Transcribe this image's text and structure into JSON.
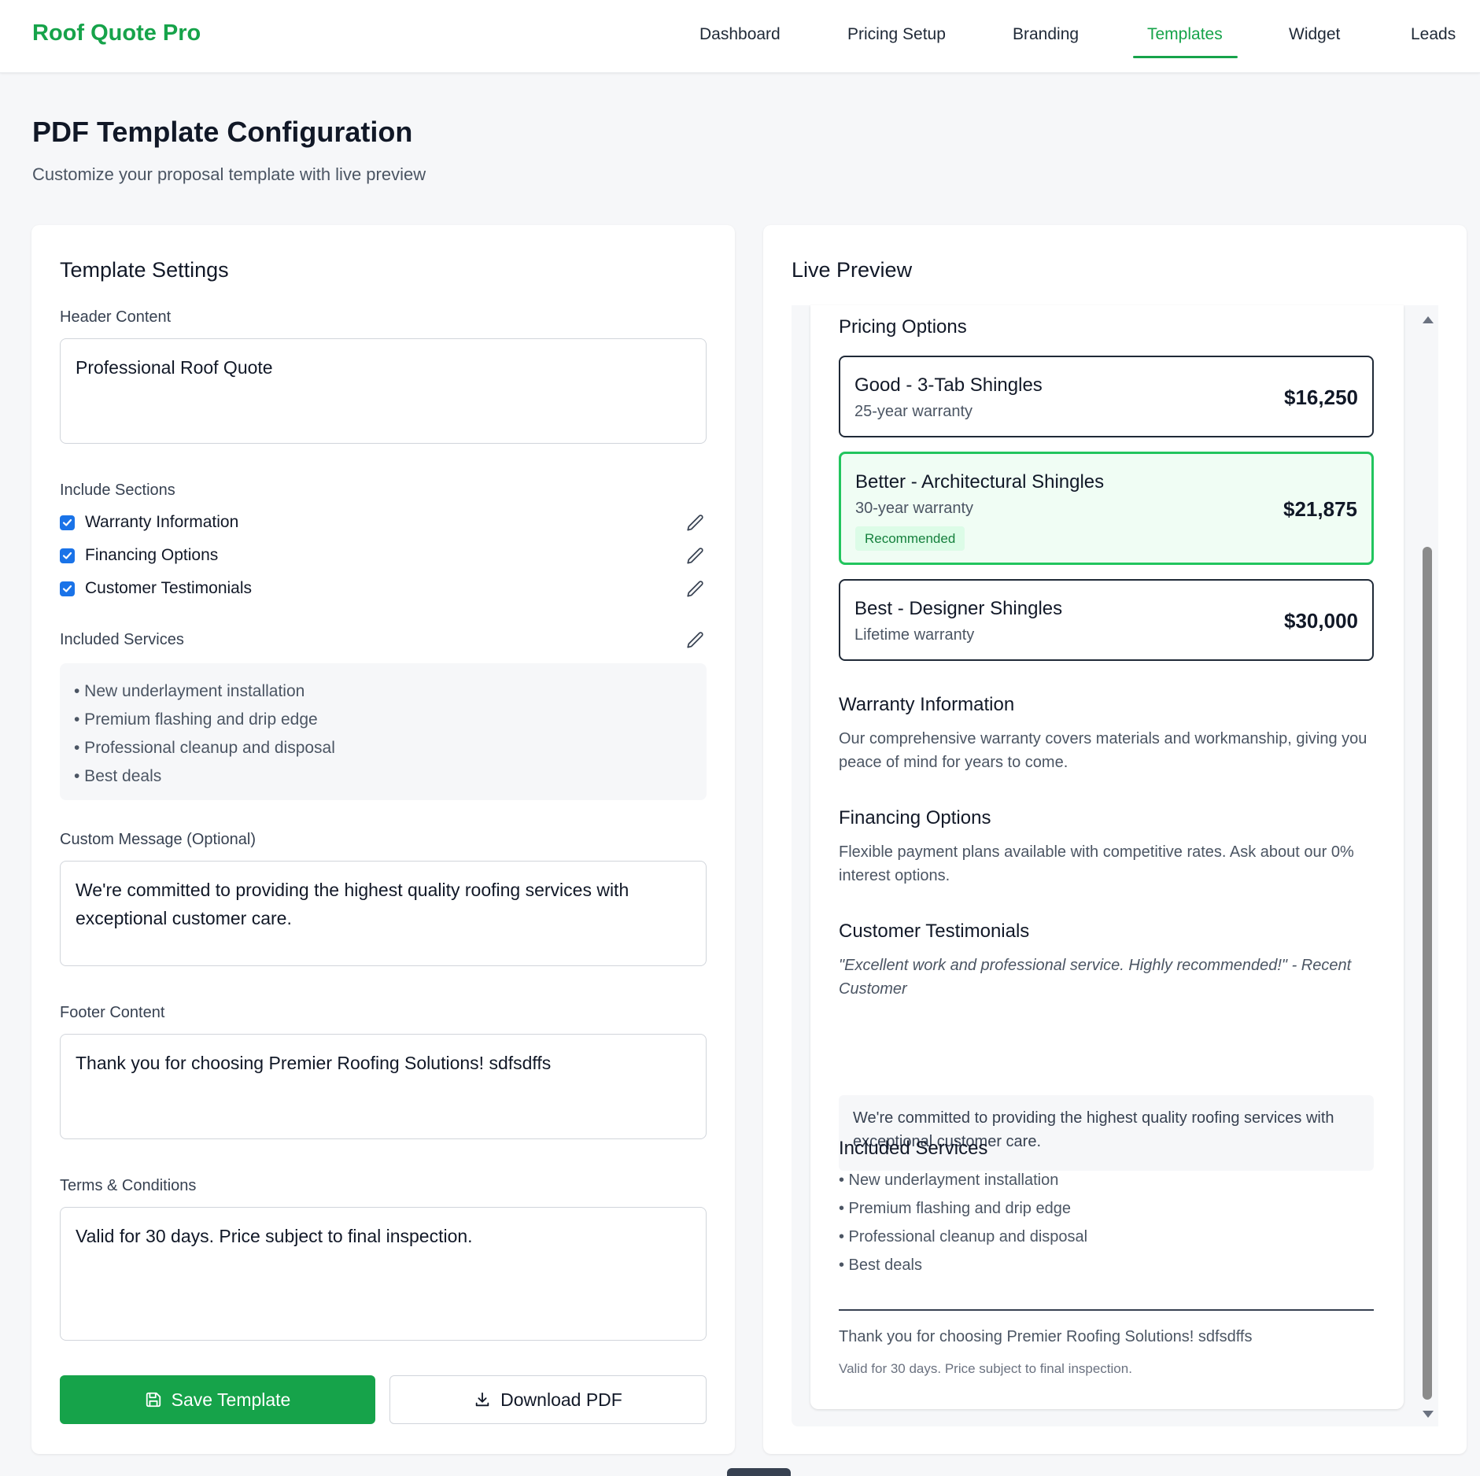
{
  "app": {
    "brand": "Roof Quote Pro",
    "accent": "#16a34a"
  },
  "nav": {
    "items": [
      "Dashboard",
      "Pricing Setup",
      "Branding",
      "Templates",
      "Widget",
      "Leads"
    ],
    "active": "Templates"
  },
  "page": {
    "title": "PDF Template Configuration",
    "subtitle": "Customize your proposal template with live preview"
  },
  "settings": {
    "title": "Template Settings",
    "header_label": "Header Content",
    "header_value": "Professional Roof Quote",
    "sections_label": "Include Sections",
    "sections": [
      {
        "label": "Warranty Information",
        "checked": true
      },
      {
        "label": "Financing Options",
        "checked": true
      },
      {
        "label": "Customer Testimonials",
        "checked": true
      }
    ],
    "services_label": "Included Services",
    "services": [
      "• New underlayment installation",
      "• Premium flashing and drip edge",
      "• Professional cleanup and disposal",
      "• Best deals"
    ],
    "message_label": "Custom Message (Optional)",
    "message_value": "We're committed to providing the highest quality roofing services with exceptional customer care.",
    "footer_label": "Footer Content",
    "footer_value": "Thank you for choosing Premier Roofing Solutions! sdfsdffs",
    "terms_label": "Terms & Conditions",
    "terms_value": "Valid for 30 days. Price subject to final inspection.",
    "save_label": "Save Template",
    "download_label": "Download PDF"
  },
  "preview": {
    "title": "Live Preview",
    "pricing_heading": "Pricing Options",
    "options": [
      {
        "name": "Good - 3-Tab Shingles",
        "warranty": "25-year warranty",
        "price": "$16,250"
      },
      {
        "name": "Better - Architectural Shingles",
        "warranty": "30-year warranty",
        "price": "$21,875",
        "badge": "Recommended"
      },
      {
        "name": "Best - Designer Shingles",
        "warranty": "Lifetime warranty",
        "price": "$30,000"
      }
    ],
    "warranty_heading": "Warranty Information",
    "warranty_text": "Our comprehensive warranty covers materials and workmanship, giving you peace of mind for years to come.",
    "financing_heading": "Financing Options",
    "financing_text": "Flexible payment plans available with competitive rates. Ask about our 0% interest options.",
    "testimonials_heading": "Customer Testimonials",
    "testimonial_text": "\"Excellent work and professional service. Highly recommended!\" - Recent Customer",
    "message": "We're committed to providing the highest quality roofing services with exceptional customer care.",
    "services_heading": "Included Services",
    "services": [
      "• New underlayment installation",
      "• Premium flashing and drip edge",
      "• Professional cleanup and disposal",
      "• Best deals"
    ],
    "footer": "Thank you for choosing Premier Roofing Solutions! sdfsdffs",
    "terms": "Valid for 30 days. Price subject to final inspection."
  }
}
